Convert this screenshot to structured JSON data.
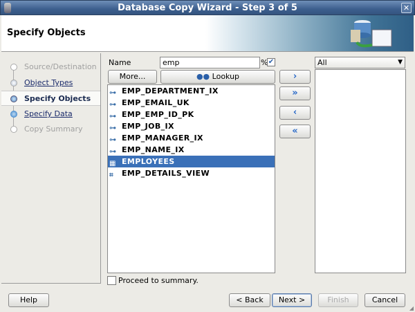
{
  "window": {
    "title": "Database Copy Wizard - Step 3 of 5",
    "close_icon": "close-icon"
  },
  "header": {
    "title": "Specify Objects"
  },
  "nav": {
    "steps": [
      {
        "label": "Source/Destination",
        "state": "disabled"
      },
      {
        "label": "Object Types",
        "state": "link"
      },
      {
        "label": "Specify Objects",
        "state": "current"
      },
      {
        "label": "Specify Data",
        "state": "link"
      },
      {
        "label": "Copy Summary",
        "state": "disabled"
      }
    ]
  },
  "filter": {
    "name_label": "Name",
    "name_value": "emp",
    "wildcard_label": "%",
    "wildcard_checked": true,
    "more_label": "More...",
    "lookup_label": "Lookup"
  },
  "available": {
    "items": [
      {
        "label": "EMP_DEPARTMENT_IX",
        "icon": "index-icon"
      },
      {
        "label": "EMP_EMAIL_UK",
        "icon": "index-icon"
      },
      {
        "label": "EMP_EMP_ID_PK",
        "icon": "index-icon"
      },
      {
        "label": "EMP_JOB_IX",
        "icon": "index-icon"
      },
      {
        "label": "EMP_MANAGER_IX",
        "icon": "index-icon"
      },
      {
        "label": "EMP_NAME_IX",
        "icon": "index-icon"
      },
      {
        "label": "EMPLOYEES",
        "icon": "table-icon",
        "selected": true
      },
      {
        "label": "EMP_DETAILS_VIEW",
        "icon": "view-icon"
      }
    ]
  },
  "shuttle": {
    "move": "›",
    "move_all": "»",
    "remove": "‹",
    "remove_all": "«"
  },
  "selected": {
    "filter_value": "All",
    "items": []
  },
  "proceed": {
    "label": "Proceed to summary.",
    "checked": false
  },
  "footer": {
    "help": "Help",
    "back": "< Back",
    "next": "Next >",
    "finish": "Finish",
    "cancel": "Cancel"
  }
}
